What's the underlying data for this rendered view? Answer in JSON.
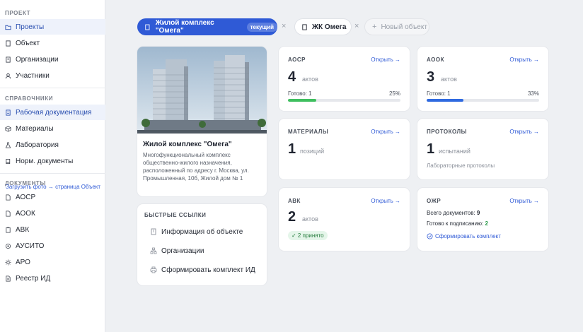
{
  "sidebar": {
    "section_project": "ПРОЕКТ",
    "section_refs": "СПРАВОЧНИКИ",
    "section_docs": "ДОКУМЕНТЫ",
    "project_items": [
      {
        "label": "Проекты",
        "icon": "folder-icon"
      },
      {
        "label": "Объект",
        "icon": "document-icon"
      },
      {
        "label": "Организации",
        "icon": "building-icon"
      },
      {
        "label": "Участники",
        "icon": "user-icon"
      }
    ],
    "ref_items": [
      {
        "label": "Рабочая документация",
        "icon": "file-text-icon"
      },
      {
        "label": "Материалы",
        "icon": "box-icon"
      },
      {
        "label": "Лаборатория",
        "icon": "flask-icon"
      },
      {
        "label": "Норм. документы",
        "icon": "book-icon"
      }
    ],
    "doc_items": [
      {
        "label": "АОСР",
        "icon": "file-icon"
      },
      {
        "label": "АООК",
        "icon": "file-icon"
      },
      {
        "label": "АВК",
        "icon": "clipboard-icon"
      },
      {
        "label": "АУСИТО",
        "icon": "settings-icon"
      },
      {
        "label": "АРО",
        "icon": "sun-icon"
      },
      {
        "label": "Реестр ИД",
        "icon": "list-icon"
      }
    ]
  },
  "tabs": {
    "main_label": "Жилой комплекс \"Омега\"",
    "current_badge": "текущий",
    "close_glyph": "×",
    "second_label": "ЖК Омега",
    "new_plus": "+",
    "new_label": "Новый объект"
  },
  "object": {
    "title": "Жилой комплекс \"Омега\"",
    "description": "Многофункциональный комплекс общественно-жилого назначения, расположенный по адресу г. Москва, ул. Промышленная, 10б, Жилой дом № 1",
    "link": "Загрузить фото → страница Объект"
  },
  "quick_links": {
    "title": "БЫСТРЫЕ ССЫЛКИ",
    "items": [
      {
        "label": "Информация об объекте",
        "icon": "building-icon"
      },
      {
        "label": "Организации",
        "icon": "sitemap-icon"
      },
      {
        "label": "Сформировать комплект ИД",
        "icon": "printer-icon"
      }
    ]
  },
  "cards": {
    "open_label": "Открыть →",
    "aosr": {
      "title": "АОСР",
      "count": "4",
      "unit": "актов",
      "ready": "Готово: 1",
      "percent": "25%",
      "progress": 0.25,
      "color": "#3fbf5f"
    },
    "aook": {
      "title": "АООК",
      "count": "3",
      "unit": "актов",
      "ready": "Готово: 1",
      "percent": "33%",
      "progress": 0.33,
      "color": "#2f6ae0"
    },
    "materials": {
      "title": "МАТЕРИАЛЫ",
      "count": "1",
      "unit": "позиций"
    },
    "protocols": {
      "title": "ПРОТОКОЛЫ",
      "count": "1",
      "unit": "испытаний",
      "subtitle": "Лабораторные протоколы"
    },
    "avk": {
      "title": "АВК",
      "count": "2",
      "unit": "актов",
      "badge": "✓ 2 принято"
    },
    "ozhr": {
      "title": "ОЖР",
      "total_label": "Всего документов:",
      "total_value": "9",
      "ready_label": "Готово к подписанию:",
      "ready_value": "2",
      "action": "Сформировать комплект"
    }
  }
}
